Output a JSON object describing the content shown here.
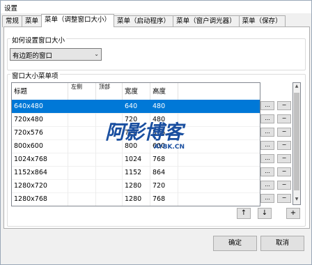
{
  "window": {
    "title": "设置"
  },
  "tabs": [
    {
      "label": "常规"
    },
    {
      "label": "菜单"
    },
    {
      "label": "菜单（调整窗口大小）",
      "active": true
    },
    {
      "label": "菜单（启动程序）"
    },
    {
      "label": "菜单（窗户调光器）"
    },
    {
      "label": "菜单（保存）"
    }
  ],
  "resize_group": {
    "label": "如何设置窗口大小",
    "select_value": "有边距的窗口"
  },
  "items_group": {
    "label": "窗口大小菜单项",
    "columns": [
      "标题",
      "左侧",
      "顶部",
      "宽度",
      "高度"
    ],
    "rows": [
      {
        "title": "640x480",
        "left": "",
        "top": "",
        "width": "640",
        "height": "480",
        "selected": true
      },
      {
        "title": "720x480",
        "left": "",
        "top": "",
        "width": "720",
        "height": "480"
      },
      {
        "title": "720x576",
        "left": "",
        "top": "",
        "width": "720",
        "height": "576"
      },
      {
        "title": "800x600",
        "left": "",
        "top": "",
        "width": "800",
        "height": "600"
      },
      {
        "title": "1024x768",
        "left": "",
        "top": "",
        "width": "1024",
        "height": "768"
      },
      {
        "title": "1152x864",
        "left": "",
        "top": "",
        "width": "1152",
        "height": "864"
      },
      {
        "title": "1280x720",
        "left": "",
        "top": "",
        "width": "1280",
        "height": "720"
      },
      {
        "title": "1280x768",
        "left": "",
        "top": "",
        "width": "1280",
        "height": "768"
      }
    ],
    "row_edit_label": "...",
    "row_remove_label": "−",
    "move_up_label": "↑",
    "move_down_label": "↓",
    "add_label": "+"
  },
  "buttons": {
    "ok": "确定",
    "cancel": "取消"
  },
  "watermark": {
    "main": "阿影博客",
    "sub": "AYBK.CN"
  },
  "colors": {
    "selection": "#0078d7",
    "watermark": "#1a4fa0"
  }
}
